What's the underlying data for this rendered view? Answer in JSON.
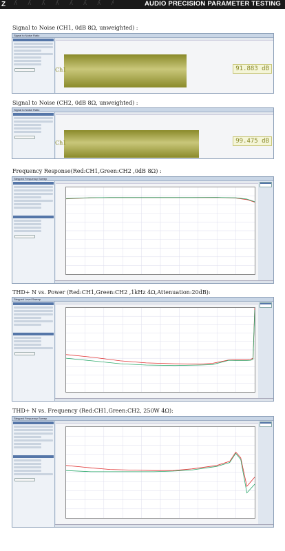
{
  "header": {
    "logo": "Z",
    "decor_text": "ʎ ʎ ʎ ʎ ʎ ʎ ʎ ʎ",
    "title": "AUDIO PRECISION PARAMETER TESTING"
  },
  "sections": {
    "snr_ch1": {
      "caption": "Signal to Noise (CH1, 0dB 8Ω, unweighted) :",
      "window_title": "Signal to Noise Ratio",
      "channel": "Ch1",
      "value": "91.883 dB"
    },
    "snr_ch2": {
      "caption": "Signal to Noise (CH2, 0dB 8Ω, unweighted) :",
      "window_title": "Signal to Noise Ratio",
      "channel": "Ch1",
      "value": "99.475 dB"
    },
    "freq_resp": {
      "caption": "Frequency Response(Red:CH1,Green:CH2 ,0dB 8Ω) :",
      "window_title": "Stepped Frequency Sweep"
    },
    "thd_power": {
      "caption": "THD+ N vs. Power (Red:CH1,Green:CH2 ,1kHz 4Ω,Attenuation:20dB):",
      "window_title": "Stepped Level Sweep"
    },
    "thd_freq": {
      "caption": "THD+ N vs. Frequency (Red:CH1,Green:CH2, 250W 4Ω):",
      "window_title": "Stepped Frequency Sweep"
    }
  },
  "colors": {
    "ch1": "#e03030",
    "ch2": "#2aa86a",
    "meter": "#8a8a2a"
  },
  "chart_data": [
    {
      "type": "line",
      "x": [
        20,
        50,
        100,
        200,
        500,
        1000,
        2000,
        5000,
        10000,
        15000,
        20000
      ],
      "series": [
        {
          "values": [
            -0.25,
            -0.05,
            0,
            0,
            0,
            0,
            0,
            0.02,
            -0.1,
            -0.4,
            -0.9
          ]
        },
        {
          "values": [
            -0.2,
            -0.03,
            0,
            0,
            0,
            0,
            0,
            0.03,
            -0.05,
            -0.3,
            -0.8
          ]
        }
      ],
      "xscale": "log",
      "xlim": [
        20,
        20000
      ],
      "ylim": [
        -15,
        2
      ],
      "grid": true,
      "legend": "right"
    },
    {
      "type": "line",
      "x": [
        0.1,
        0.3,
        1,
        3,
        10,
        30,
        50,
        100,
        150,
        200,
        250,
        280,
        300
      ],
      "series": [
        {
          "values": [
            0.06,
            0.045,
            0.03,
            0.024,
            0.022,
            0.021,
            0.023,
            0.033,
            0.034,
            0.034,
            0.035,
            0.04,
            10
          ]
        },
        {
          "values": [
            0.04,
            0.03,
            0.022,
            0.019,
            0.018,
            0.019,
            0.02,
            0.032,
            0.031,
            0.031,
            0.032,
            0.035,
            8
          ]
        }
      ],
      "xscale": "log",
      "yscale": "log",
      "ylim": [
        0.001,
        10
      ],
      "grid": true,
      "legend": "right"
    },
    {
      "type": "line",
      "x": [
        20,
        50,
        100,
        200,
        500,
        1000,
        2000,
        5000,
        8000,
        10000,
        12000,
        15000,
        20000
      ],
      "series": [
        {
          "values": [
            0.05,
            0.045,
            0.042,
            0.041,
            0.04,
            0.04,
            0.043,
            0.05,
            0.06,
            0.09,
            0.07,
            0.02,
            0.03
          ]
        },
        {
          "values": [
            0.04,
            0.038,
            0.038,
            0.038,
            0.038,
            0.039,
            0.041,
            0.048,
            0.057,
            0.085,
            0.065,
            0.015,
            0.022
          ]
        }
      ],
      "xscale": "log",
      "yscale": "log",
      "xlim": [
        20,
        20000
      ],
      "grid": true,
      "legend": "right"
    }
  ]
}
